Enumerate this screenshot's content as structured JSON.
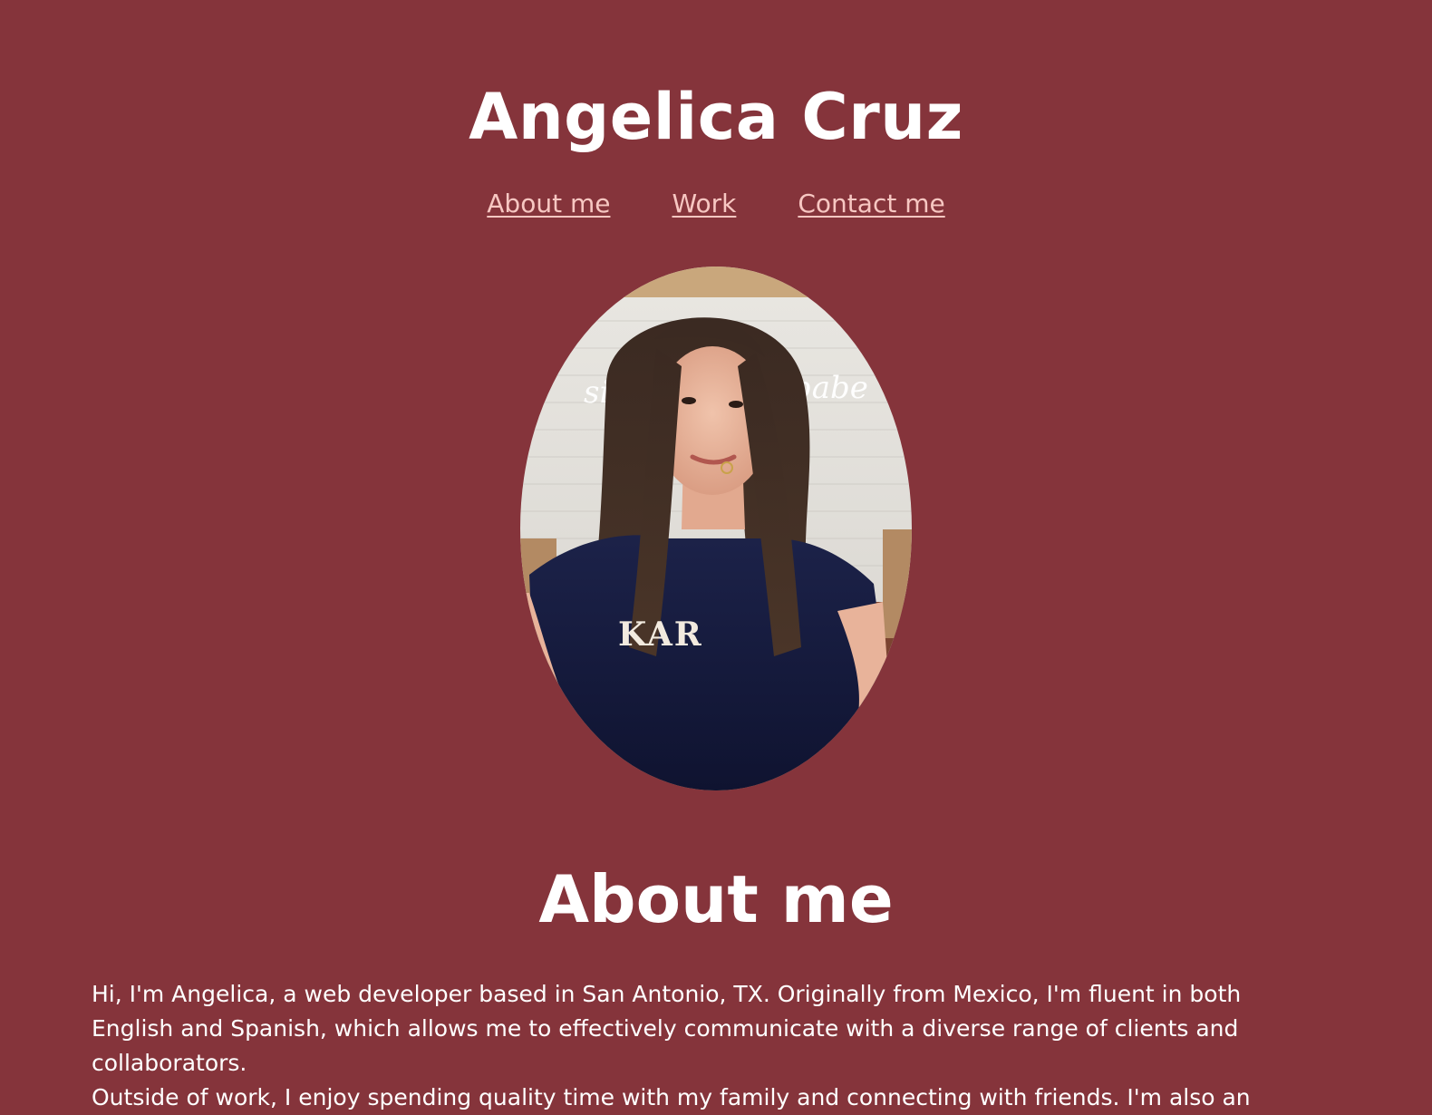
{
  "site": {
    "title": "Angelica Cruz",
    "background_color": "#85343b",
    "link_color": "#f7c7c2"
  },
  "nav": {
    "items": [
      {
        "label": "About me"
      },
      {
        "label": "Work"
      },
      {
        "label": "Contact me"
      }
    ]
  },
  "portrait": {
    "description_icon": "portrait-photo",
    "neon_sign_text": "sip sip babe",
    "shirt_text": "KAR"
  },
  "about": {
    "heading": "About me",
    "paragraphs": [
      "Hi, I'm Angelica, a web developer based in San Antonio, TX. Originally from Mexico, I'm fluent in both English and Spanish, which allows me to effectively communicate with a diverse range of clients and collaborators.",
      "Outside of work, I enjoy spending quality time with my family and connecting with friends. I'm also an"
    ]
  }
}
